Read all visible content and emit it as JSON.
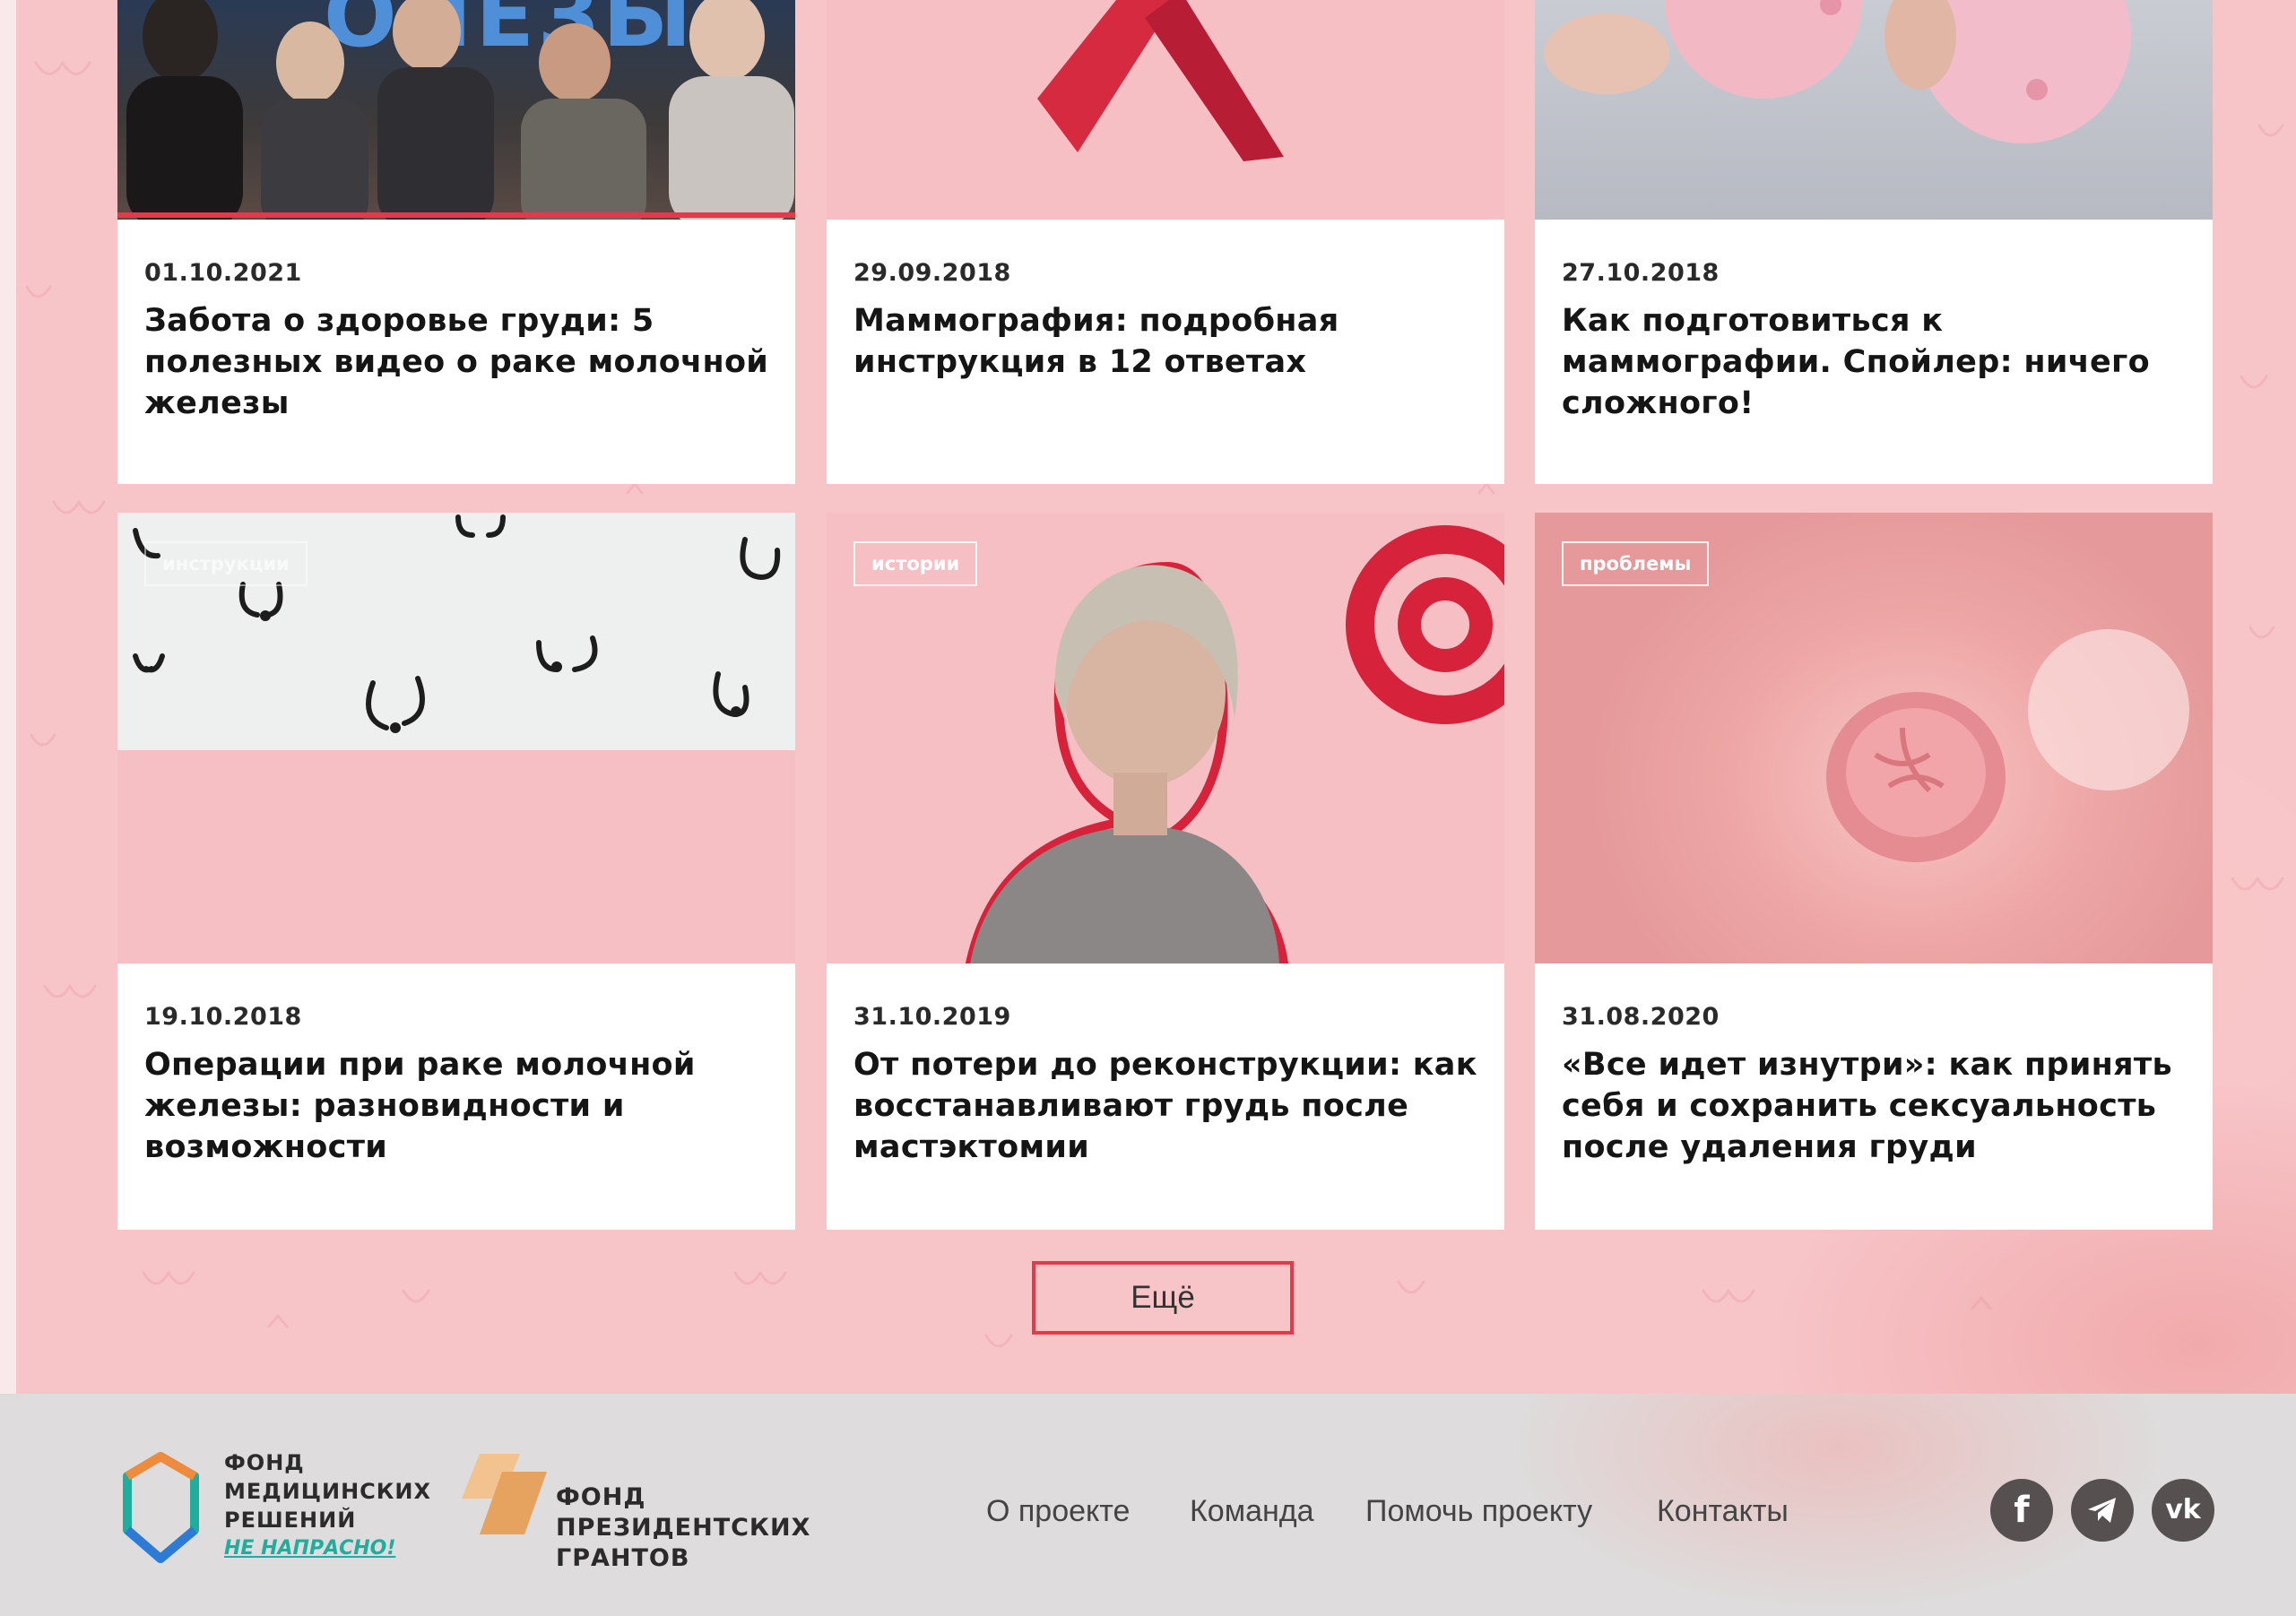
{
  "cards": [
    {
      "date": "01.10.2021",
      "title": "Забота о здоровье груди: 5 полезных видео о раке молочной железы",
      "tag": ""
    },
    {
      "date": "29.09.2018",
      "title": "Маммография: подробная инструкция в 12 ответах",
      "tag": ""
    },
    {
      "date": "27.10.2018",
      "title": "Как подготовиться к маммографии. Спойлер: ничего сложного!",
      "tag": ""
    },
    {
      "date": "19.10.2018",
      "title": "Операции при раке молочной железы: разновидности и возможности",
      "tag": "инструкции"
    },
    {
      "date": "31.10.2019",
      "title": "От потери до реконструкции: как восстанавливают грудь после мастэктомии",
      "tag": "истории"
    },
    {
      "date": "31.08.2020",
      "title": "«Все идет изнутри»: как принять себя и сохранить сексуальность после удаления груди",
      "tag": "проблемы"
    }
  ],
  "hero_text": "ОЛЕЗЫ",
  "more_button": "Ещё",
  "footer": {
    "logo1": {
      "line1": "ФОНД",
      "line2": "МЕДИЦИНСКИХ",
      "line3": "РЕШЕНИЙ",
      "tagline": "НЕ НАПРАСНО!"
    },
    "logo2": {
      "line1": "ФОНД",
      "line2": "ПРЕЗИДЕНТСКИХ",
      "line3": "ГРАНТОВ"
    },
    "nav": [
      "О проекте",
      "Команда",
      "Помочь проекту",
      "Контакты"
    ],
    "social": {
      "facebook": "f",
      "telegram": "telegram-icon",
      "vk": "vk"
    }
  },
  "colors": {
    "accent": "#e23a48",
    "pink_bg": "#f7c5c8",
    "footer_bg": "#dedcdc",
    "social_bg": "#565050",
    "teal": "#1fae9e",
    "orange": "#f08a3c",
    "blue": "#2d7bd6"
  }
}
